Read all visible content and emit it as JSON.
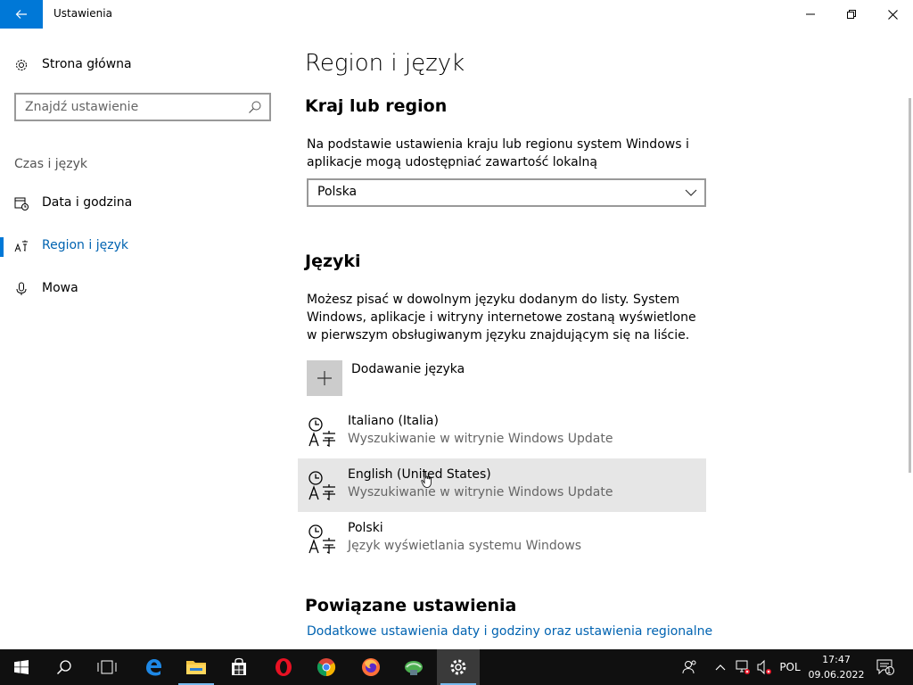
{
  "window": {
    "title": "Ustawienia"
  },
  "sidebar": {
    "home_label": "Strona główna",
    "search_placeholder": "Znajdź ustawienie",
    "section_header": "Czas i język",
    "items": [
      {
        "label": "Data i godzina",
        "icon": "calendar-clock-icon"
      },
      {
        "label": "Region i język",
        "icon": "language-icon",
        "active": true
      },
      {
        "label": "Mowa",
        "icon": "microphone-icon"
      }
    ]
  },
  "main": {
    "page_title": "Region i język",
    "country_heading": "Kraj lub region",
    "country_description": "Na podstawie ustawienia kraju lub regionu system Windows i aplikacje mogą udostępniać zawartość lokalną",
    "country_value": "Polska",
    "languages_heading": "Języki",
    "languages_description": "Możesz pisać w dowolnym języku dodanym do listy. System Windows, aplikacje i witryny internetowe zostaną wyświetlone w pierwszym obsługiwanym języku znajdującym się na liście.",
    "add_language_label": "Dodawanie języka",
    "languages": [
      {
        "name": "Italiano (Italia)",
        "status": "Wyszukiwanie w witrynie Windows Update"
      },
      {
        "name": "English (United States)",
        "status": "Wyszukiwanie w witrynie Windows Update"
      },
      {
        "name": "Polski",
        "status": "Język wyświetlania systemu Windows"
      }
    ],
    "related_heading": "Powiązane ustawienia",
    "related_link": "Dodatkowe ustawienia daty i godziny oraz ustawienia regionalne"
  },
  "taskbar": {
    "language_indicator": "POL",
    "time": "17:47",
    "date": "09.06.2022",
    "notification_count": "1"
  },
  "colors": {
    "accent": "#0078d7",
    "link": "#0063b1",
    "taskbar": "#101010"
  }
}
